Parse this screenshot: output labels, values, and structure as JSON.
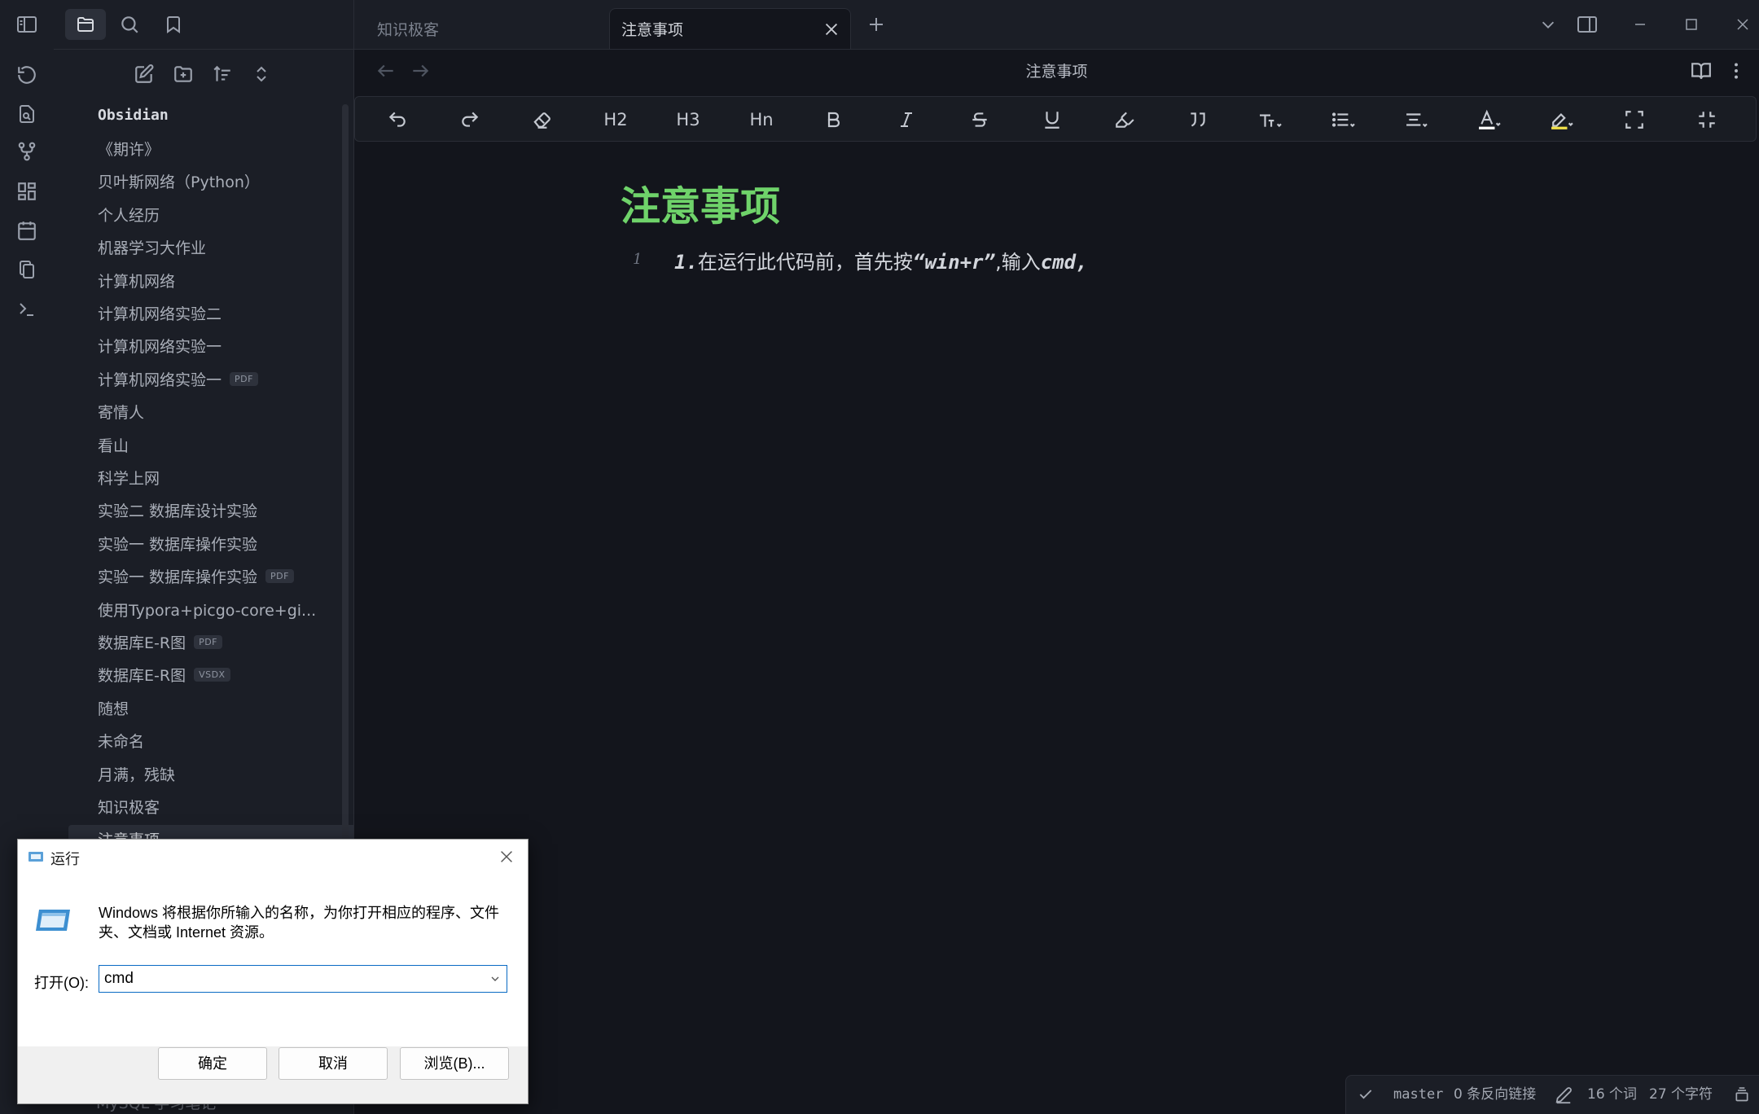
{
  "sidebar": {
    "vault_name": "Obsidian",
    "files": [
      {
        "name": "《期许》"
      },
      {
        "name": "贝叶斯网络（Python）"
      },
      {
        "name": "个人经历"
      },
      {
        "name": "机器学习大作业"
      },
      {
        "name": "计算机网络"
      },
      {
        "name": "计算机网络实验二"
      },
      {
        "name": "计算机网络实验一"
      },
      {
        "name": "计算机网络实验一",
        "badge": "PDF"
      },
      {
        "name": "寄情人"
      },
      {
        "name": "看山"
      },
      {
        "name": "科学上网"
      },
      {
        "name": "实验二  数据库设计实验"
      },
      {
        "name": "实验一  数据库操作实验"
      },
      {
        "name": "实验一  数据库操作实验",
        "badge": "PDF"
      },
      {
        "name": "使用Typora+picgo-core+gi..."
      },
      {
        "name": "数据库E-R图",
        "badge": "PDF"
      },
      {
        "name": "数据库E-R图",
        "badge": "VSDX"
      },
      {
        "name": "随想"
      },
      {
        "name": "未命名"
      },
      {
        "name": "月满，残缺"
      },
      {
        "name": "知识极客"
      },
      {
        "name": "注意事项",
        "active": true
      }
    ],
    "behind_dialog_item": "MySQL 学习笔记"
  },
  "tabs": [
    {
      "label": "知识极客"
    },
    {
      "label": "注意事项"
    }
  ],
  "view": {
    "title": "注意事项"
  },
  "toolbar": {
    "h2": "H2",
    "h3": "H3",
    "hn": "Hn"
  },
  "note": {
    "title": "注意事项",
    "line_number": "1",
    "line_prefix": "1.",
    "line_text_a": "在运行此代码前，首先按",
    "line_code_a": "“win+r”",
    "line_text_b": ",输入",
    "line_code_b": "cmd,"
  },
  "status": {
    "branch": "master",
    "backlinks": "0 条反向链接",
    "words": "16 个词",
    "chars": "27 个字符"
  },
  "run_dialog": {
    "title": "运行",
    "description": "Windows 将根据你所输入的名称，为你打开相应的程序、文件夹、文档或 Internet 资源。",
    "open_label": "打开(O):",
    "input_value": "cmd",
    "ok": "确定",
    "cancel": "取消",
    "browse": "浏览(B)..."
  },
  "colors": {
    "title_green": "#6fd36a",
    "background": "#13151c",
    "sidebar": "#1b1e26"
  }
}
